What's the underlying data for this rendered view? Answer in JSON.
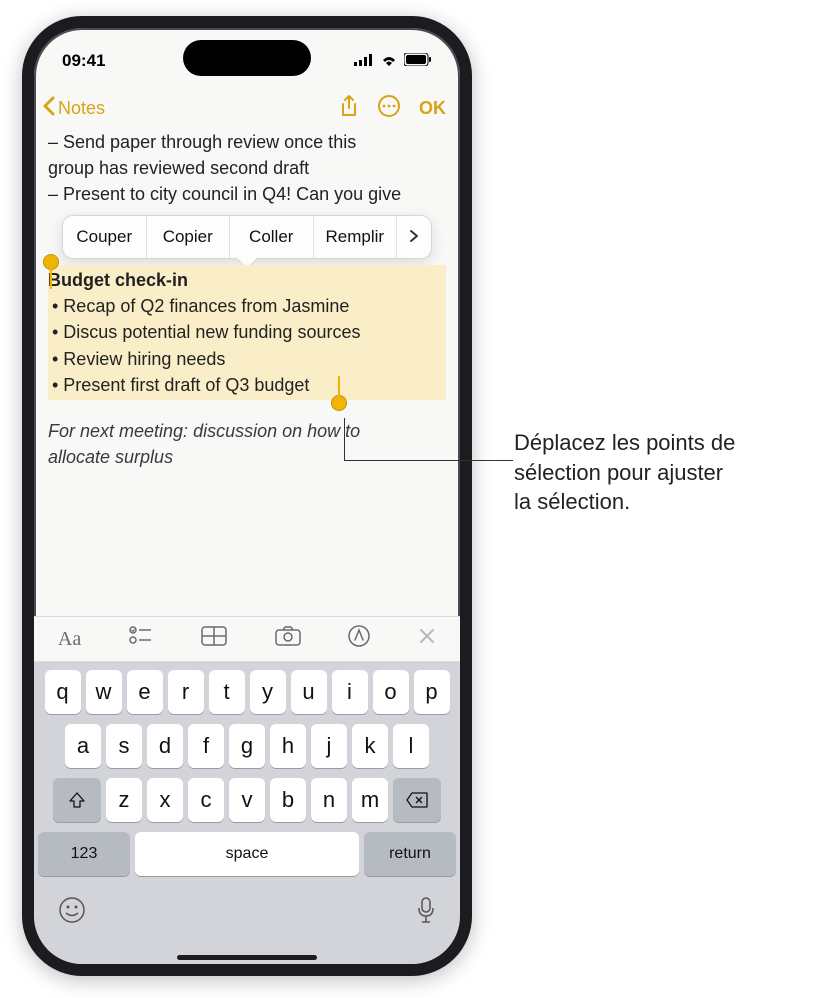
{
  "status": {
    "time": "09:41"
  },
  "nav": {
    "back_label": "Notes",
    "ok_label": "OK"
  },
  "note": {
    "line1": "– Send paper through review once this",
    "line2": "group has reviewed second draft",
    "line3": "– Present to city council in Q4! Can you give"
  },
  "context_menu": {
    "cut": "Couper",
    "copy": "Copier",
    "paste": "Coller",
    "fill": "Remplir"
  },
  "selection": {
    "title": "Budget check-in",
    "l1": "• Recap of Q2 finances from Jasmine",
    "l2": "• Discus potential new funding sources",
    "l3": "• Review hiring needs",
    "l4": "• Present first draft of Q3 budget"
  },
  "after_selection": {
    "l1": "For next meeting: discussion on how to",
    "l2": "allocate surplus"
  },
  "keyboard": {
    "row1": [
      "q",
      "w",
      "e",
      "r",
      "t",
      "y",
      "u",
      "i",
      "o",
      "p"
    ],
    "row2": [
      "a",
      "s",
      "d",
      "f",
      "g",
      "h",
      "j",
      "k",
      "l"
    ],
    "row3": [
      "z",
      "x",
      "c",
      "v",
      "b",
      "n",
      "m"
    ],
    "numbers": "123",
    "space": "space",
    "return": "return"
  },
  "callout": {
    "text_l1": "Déplacez les points de",
    "text_l2": "sélection pour ajuster",
    "text_l3": "la sélection."
  }
}
